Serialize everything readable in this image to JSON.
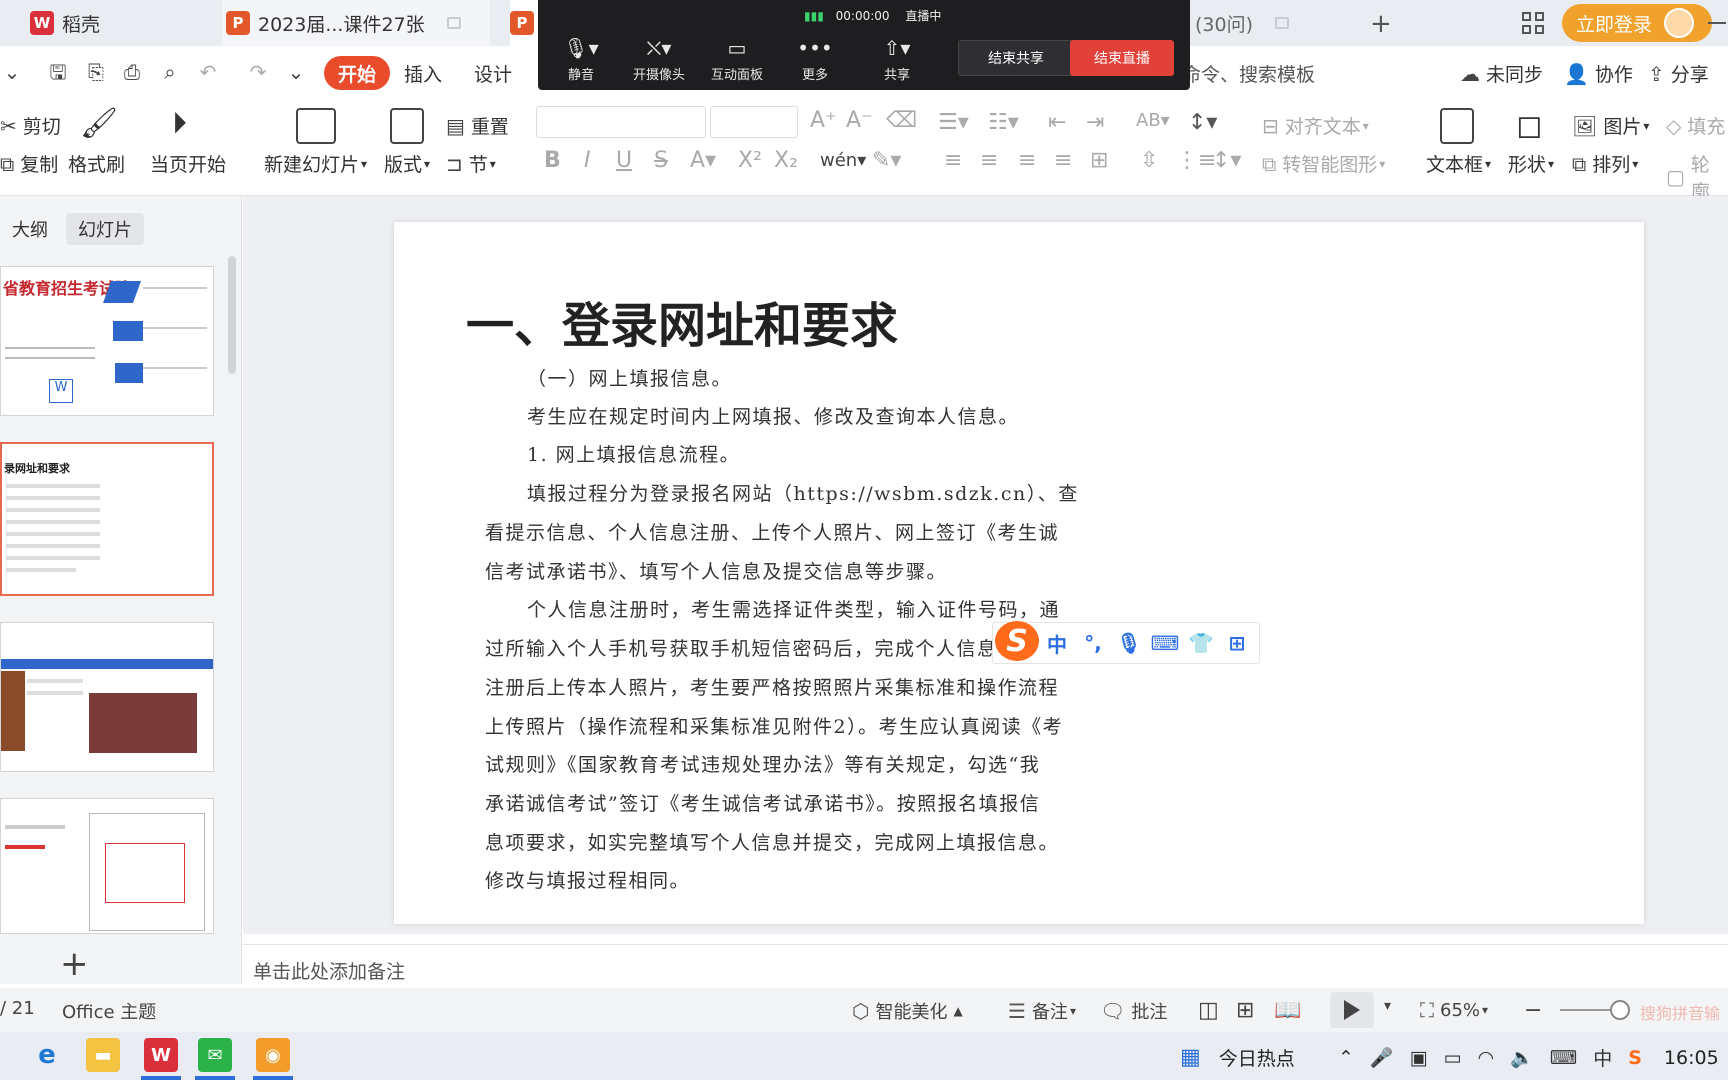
{
  "tabs": {
    "docer": "稻壳",
    "ppt1": "2023届...课件27张",
    "ghost": "(30问)"
  },
  "window": {
    "login": "立即登录"
  },
  "menu": {
    "start": "开始",
    "insert": "插入",
    "design": "设计",
    "search": "命令、搜索模板",
    "unsync": "未同步",
    "collab": "协作",
    "share": "分享"
  },
  "live": {
    "timer": "00:00:00",
    "status": "直播中",
    "mute": "静音",
    "camera": "开摄像头",
    "board": "互动面板",
    "more": "更多",
    "share": "共享",
    "end_share": "结束共享",
    "end_live": "结束直播"
  },
  "ribbon": {
    "cut": "剪切",
    "copy": "复制",
    "format_painter": "格式刷",
    "from_current": "当页开始",
    "new_slide": "新建幻灯片",
    "layout": "版式",
    "reset": "重置",
    "section": "节",
    "align_text": "对齐文本",
    "smart_art": "转智能图形",
    "textbox": "文本框",
    "shape": "形状",
    "picture": "图片",
    "arrange": "排列",
    "fill": "填充",
    "outline": "轮廓"
  },
  "left_panel": {
    "outline": "大纲",
    "slides": "幻灯片",
    "thumb1_title": "省教育招生考试院",
    "thumb2_title": "录网址和要求"
  },
  "slide": {
    "title": "一、登录网址和要求",
    "lines": [
      "（一）网上填报信息。",
      "考生应在规定时间内上网填报、修改及查询本人信息。",
      "1. 网上填报信息流程。",
      "填报过程分为登录报名网站（https://wsbm.sdzk.cn）、查",
      "看提示信息、个人信息注册、上传个人照片、网上签订《考生诚",
      "信考试承诺书》、填写个人信息及提交信息等步骤。",
      "个人信息注册时，考生需选择证件类型，输入证件号码，通",
      "过所输入个人手机号获取手机短信密码后，完成个人信息注册。",
      "注册后上传本人照片，考生要严格按照照片采集标准和操作流程",
      "上传照片（操作流程和采集标准见附件2）。考生应认真阅读《考",
      "试规则》《国家教育考试违规处理办法》等有关规定，勾选“我",
      "承诺诚信考试”签订《考生诚信考试承诺书》。按照报名填报信",
      "息项要求，如实完整填写个人信息并提交，完成网上填报信息。",
      "修改与填报过程相同。"
    ]
  },
  "ime": {
    "logo": "S",
    "mode": "中",
    "punct": "°,"
  },
  "notes": {
    "placeholder": "单击此处添加备注"
  },
  "status": {
    "page": "/ 21",
    "theme": "Office 主题",
    "beautify": "智能美化",
    "notes": "备注",
    "comment": "批注",
    "zoom": "65%",
    "brand": "搜狗拼音输"
  },
  "taskbar": {
    "hot": "今日热点",
    "lang": "中",
    "time": "16:05"
  }
}
